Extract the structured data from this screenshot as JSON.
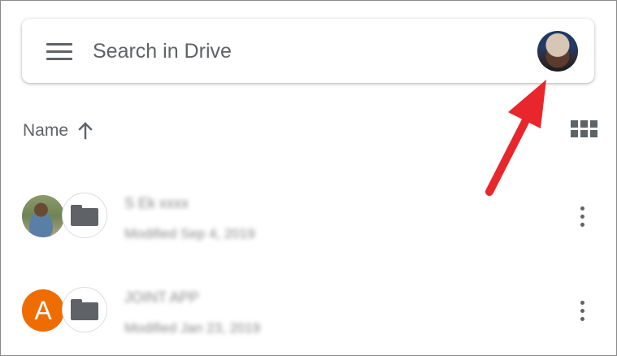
{
  "search": {
    "placeholder": "Search in Drive",
    "menu_icon": "hamburger-menu-icon",
    "account_icon": "account-avatar"
  },
  "sort": {
    "label": "Name",
    "direction_icon": "arrow-up-icon"
  },
  "view_toggle": {
    "icon": "grid-view-icon"
  },
  "files": [
    {
      "owner_avatar": "user-photo",
      "type_icon": "folder-icon",
      "name": "S Ek xxxx",
      "meta": "Modified Sep 4, 2019"
    },
    {
      "owner_avatar_letter": "A",
      "owner_avatar_color": "#ef6c00",
      "type_icon": "folder-icon",
      "name": "JOINT APP",
      "meta": "Modified Jan 23, 2019"
    }
  ],
  "colors": {
    "icon_gray": "#5f6368",
    "annotation_red": "#e8262b",
    "letter_avatar": "#ef6c00"
  }
}
